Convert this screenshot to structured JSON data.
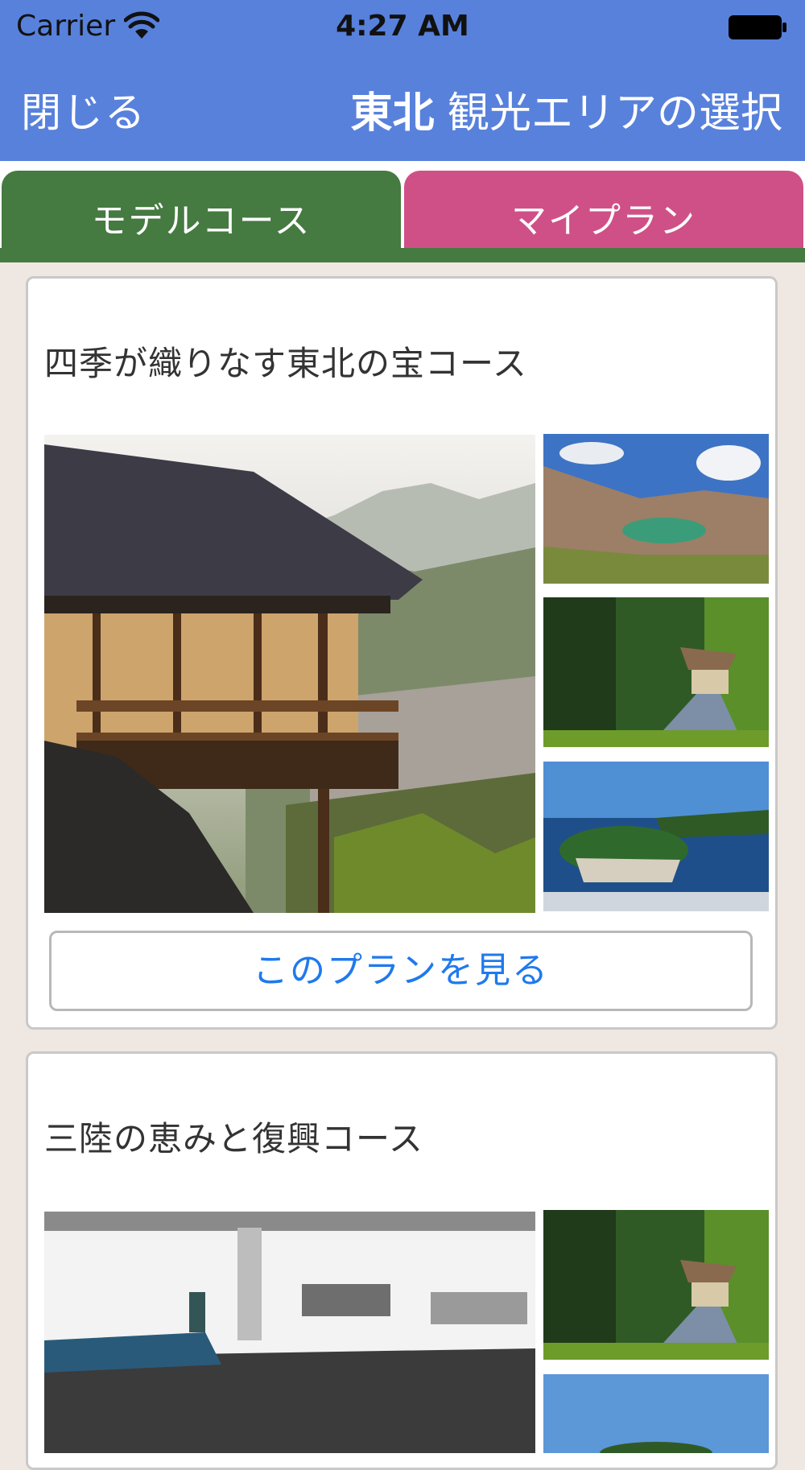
{
  "status_bar": {
    "carrier": "Carrier",
    "time": "4:27 AM"
  },
  "nav": {
    "close_label": "閉じる",
    "region": "東北",
    "title": "観光エリアの選択"
  },
  "tabs": [
    {
      "label": "モデルコース",
      "color": "#457a40",
      "selected": true
    },
    {
      "label": "マイプラン",
      "color": "#cf5087",
      "selected": false
    }
  ],
  "courses": [
    {
      "title": "四季が織りなす東北の宝コース",
      "button_label": "このプランを見る",
      "photos": [
        "mountain-temple-balcony",
        "crater-lake",
        "forest-temple-stairs",
        "island-bay"
      ]
    },
    {
      "title": "三陸の恵みと復興コース",
      "photos": [
        "fish-market",
        "forest-temple-stairs",
        "sea-island"
      ]
    }
  ],
  "colors": {
    "nav_bar": "#5881dc",
    "button_text": "#1f79ee",
    "background": "#efe7e1"
  }
}
